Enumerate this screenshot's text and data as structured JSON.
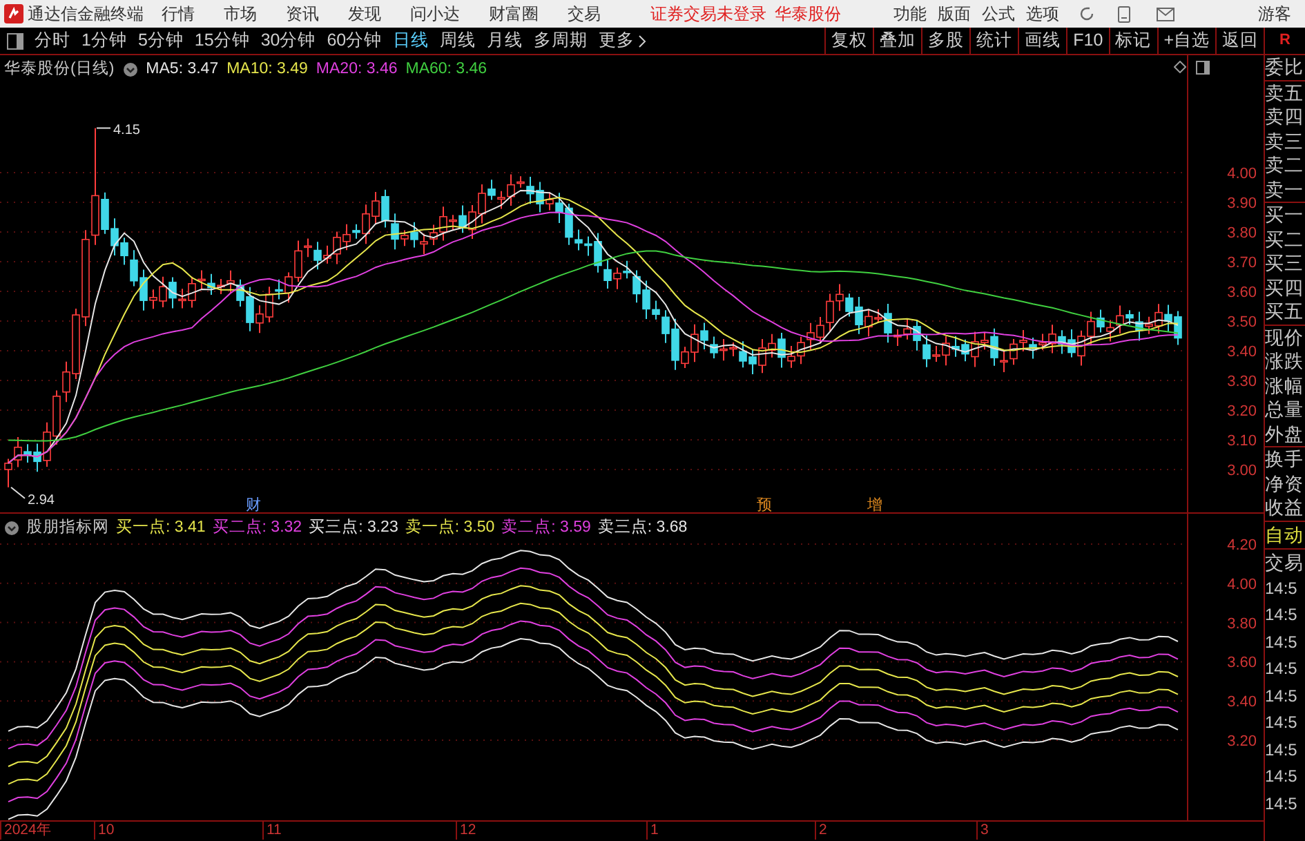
{
  "app": {
    "title": "通达信金融终端",
    "menus": [
      "行情",
      "市场",
      "资讯",
      "发现",
      "问小达",
      "财富圈",
      "交易"
    ],
    "login_status": "证券交易未登录",
    "stock_link": "华泰股份",
    "tools": [
      "功能",
      "版面",
      "公式",
      "选项"
    ],
    "user": "游客"
  },
  "periods": [
    {
      "label": "分时",
      "selected": false
    },
    {
      "label": "1分钟",
      "selected": false
    },
    {
      "label": "5分钟",
      "selected": false
    },
    {
      "label": "15分钟",
      "selected": false
    },
    {
      "label": "30分钟",
      "selected": false
    },
    {
      "label": "60分钟",
      "selected": false
    },
    {
      "label": "日线",
      "selected": true
    },
    {
      "label": "周线",
      "selected": false
    },
    {
      "label": "月线",
      "selected": false
    },
    {
      "label": "多周期",
      "selected": false
    },
    {
      "label": "更多",
      "selected": false
    }
  ],
  "chart_tools": [
    "复权",
    "叠加",
    "多股",
    "统计",
    "画线",
    "F10",
    "标记",
    "+自选",
    "返回"
  ],
  "corner_badge": "R",
  "main_chart": {
    "title": "华泰股份(日线)",
    "ma": [
      {
        "label": "MA5: 3.47",
        "color": "#e6e6e6"
      },
      {
        "label": "MA10: 3.49",
        "color": "#e6e64c"
      },
      {
        "label": "MA20: 3.46",
        "color": "#e040e0"
      },
      {
        "label": "MA60: 3.46",
        "color": "#40d040"
      }
    ],
    "yticks": [
      "4.00",
      "3.90",
      "3.80",
      "3.70",
      "3.60",
      "3.50",
      "3.40",
      "3.30",
      "3.20",
      "3.10",
      "3.00"
    ],
    "high_label": "4.15",
    "low_label": "2.94",
    "event_markers": [
      {
        "text": "财",
        "color": "#6a9cff"
      },
      {
        "text": "预",
        "color": "#e08a20"
      },
      {
        "text": "增",
        "color": "#e08a20"
      }
    ]
  },
  "indicator": {
    "name": "股朋指标网",
    "lines": [
      {
        "label": "买一点: 3.41",
        "color": "#e6e64c"
      },
      {
        "label": "买二点: 3.32",
        "color": "#e040e0"
      },
      {
        "label": "买三点: 3.23",
        "color": "#e6e6e6"
      },
      {
        "label": "卖一点: 3.50",
        "color": "#e6e64c"
      },
      {
        "label": "卖二点: 3.59",
        "color": "#e040e0"
      },
      {
        "label": "卖三点: 3.68",
        "color": "#e6e6e6"
      }
    ],
    "yticks": [
      "4.20",
      "4.00",
      "3.80",
      "3.60",
      "3.40",
      "3.20"
    ]
  },
  "dates": [
    "2024年",
    "10",
    "11",
    "12",
    "1",
    "2",
    "3"
  ],
  "right_panel": {
    "groups": [
      [
        "委比"
      ],
      [
        "卖五",
        "卖四",
        "卖三",
        "卖二",
        "卖一"
      ],
      [
        "买一",
        "买二",
        "买三",
        "买四",
        "买五"
      ],
      [
        "现价",
        "涨跌",
        "涨幅",
        "总量",
        "外盘"
      ],
      [
        "换手",
        "净资",
        "收益"
      ]
    ],
    "auto_label": "自动",
    "trade_label": "交易",
    "times": [
      "14:5",
      "14:5",
      "14:5",
      "14:5",
      "14:5",
      "14:5",
      "14:5",
      "14:5",
      "14:5"
    ]
  }
}
